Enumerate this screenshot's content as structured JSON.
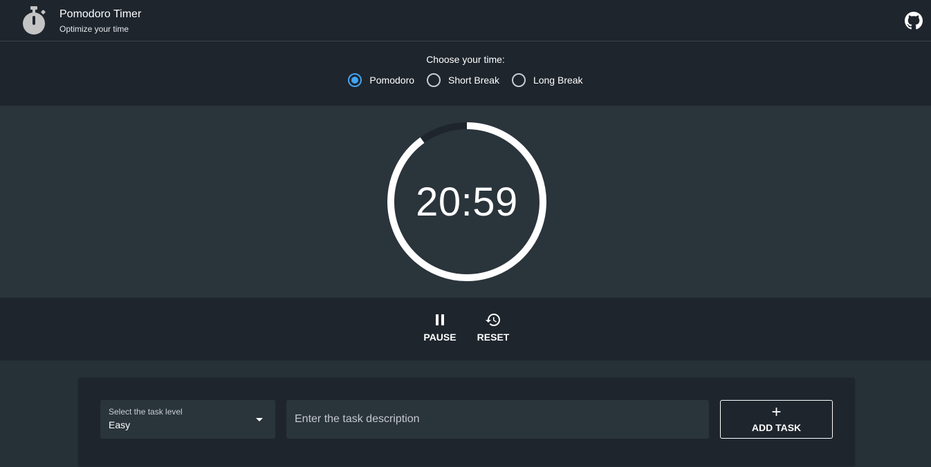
{
  "app": {
    "title": "Pomodoro Timer",
    "subtitle": "Optimize your time",
    "icons": {
      "logo": "stopwatch-icon",
      "github": "github-icon"
    }
  },
  "chooser": {
    "label": "Choose your time:",
    "options": [
      {
        "label": "Pomodoro",
        "checked": true
      },
      {
        "label": "Short Break",
        "checked": false
      },
      {
        "label": "Long Break",
        "checked": false
      }
    ]
  },
  "timer": {
    "display": "20:59",
    "progress_fraction_remaining": 0.9,
    "colors": {
      "ring": "#ffffff",
      "track": "#1e252d"
    }
  },
  "controls": {
    "pause_label": "PAUSE",
    "reset_label": "RESET",
    "icons": {
      "pause": "pause-icon",
      "reset": "history-icon"
    }
  },
  "task": {
    "level_label": "Select the task level",
    "level_value": "Easy",
    "description_placeholder": "Enter the task description",
    "add_label": "ADD TASK",
    "add_icon": "+"
  },
  "colors": {
    "accent": "#42a5f5",
    "header_bg": "#1e252d",
    "body_bg": "#2a343b"
  }
}
